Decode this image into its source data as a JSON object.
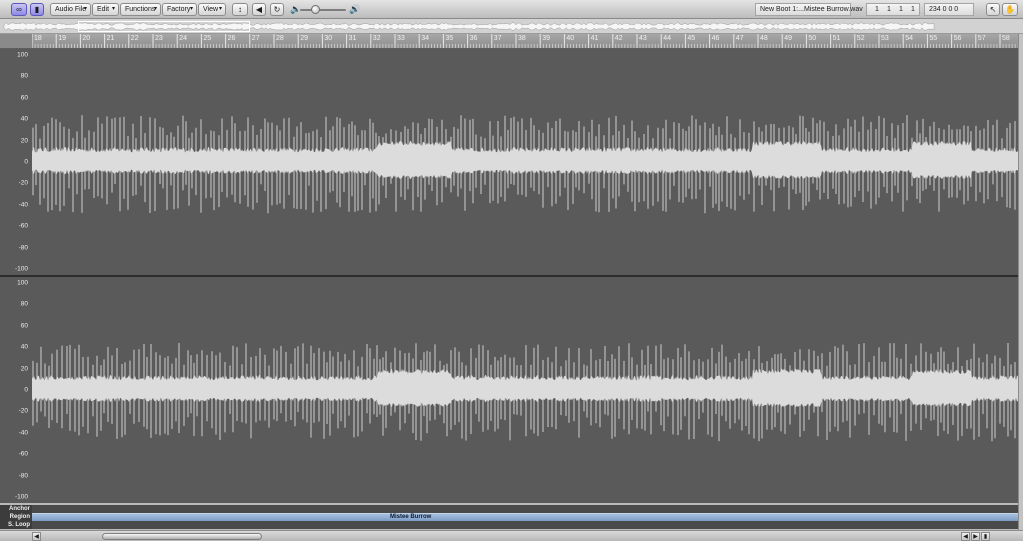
{
  "toolbar": {
    "link_icon": "link-icon",
    "catch_icon": "catch-icon",
    "menus": [
      {
        "label": "Audio File"
      },
      {
        "label": "Edit"
      },
      {
        "label": "Functions"
      },
      {
        "label": "Factory"
      },
      {
        "label": "View"
      }
    ],
    "file_info": "New Boot 1:...Mistee Burrow.wav",
    "position": [
      "1",
      "1",
      "1",
      "1"
    ],
    "tempo": "234 0 0 0",
    "accent_color": "#8e89e6"
  },
  "ruler": {
    "bars": [
      "18",
      "19",
      "20",
      "21",
      "22",
      "23",
      "24",
      "25",
      "26",
      "27",
      "28",
      "29",
      "30",
      "31",
      "32",
      "33",
      "34",
      "35",
      "36",
      "37",
      "38",
      "39",
      "40",
      "41",
      "42",
      "43",
      "44",
      "45",
      "46",
      "47",
      "48",
      "49",
      "50",
      "51",
      "52",
      "53",
      "54",
      "55",
      "56",
      "57",
      "58"
    ]
  },
  "scale": {
    "ticks": [
      "100",
      "80",
      "60",
      "40",
      "20",
      "0",
      "-20",
      "-40",
      "-60",
      "-80",
      "-100"
    ]
  },
  "rows": {
    "anchor_label": "Anchor",
    "region_label": "Region",
    "loop_label": "S. Loop",
    "region_name": "Mistee Burrow"
  },
  "colors": {
    "waveform": "#dcdcdc",
    "lane_bg": "#5a5a5a",
    "region": "#8aa7cd"
  }
}
